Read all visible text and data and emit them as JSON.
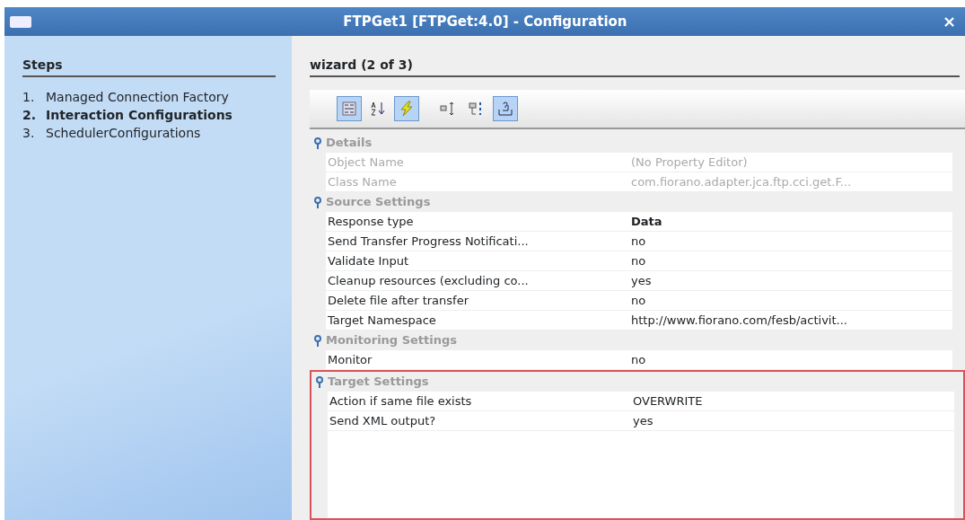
{
  "window": {
    "title": "FTPGet1 [FTPGet:4.0] - Configuration",
    "close": "×"
  },
  "steps": {
    "heading": "Steps",
    "items": [
      {
        "number": "1.",
        "label": "Managed Connection Factory",
        "selected": false
      },
      {
        "number": "2.",
        "label": "Interaction Configurations",
        "selected": true
      },
      {
        "number": "3.",
        "label": "SchedulerConfigurations",
        "selected": false
      }
    ]
  },
  "wizard": {
    "heading": "wizard (2 of 3)"
  },
  "toolbar": [
    {
      "kind": "categorized",
      "selected": true
    },
    {
      "kind": "sort",
      "selected": false
    },
    {
      "kind": "lightning",
      "selected": true
    },
    {
      "kind": "expand",
      "selected": false
    },
    {
      "kind": "collapse",
      "selected": false
    },
    {
      "kind": "help",
      "selected": true
    }
  ],
  "property_sheet": {
    "categories": [
      {
        "name": "Details",
        "highlighted": false,
        "properties": [
          {
            "name": "Object Name",
            "value": "(No Property Editor)",
            "disabled": true,
            "bold": false
          },
          {
            "name": "Class Name",
            "value": "com.fiorano.adapter.jca.ftp.cci.get.F...",
            "disabled": true,
            "bold": false
          }
        ]
      },
      {
        "name": "Source Settings",
        "highlighted": false,
        "properties": [
          {
            "name": "Response type",
            "value": "Data",
            "disabled": false,
            "bold": true
          },
          {
            "name": "Send Transfer Progress Notificati...",
            "value": "no",
            "disabled": false,
            "bold": false
          },
          {
            "name": "Validate Input",
            "value": "no",
            "disabled": false,
            "bold": false
          },
          {
            "name": "Cleanup resources (excluding co...",
            "value": "yes",
            "disabled": false,
            "bold": false
          },
          {
            "name": "Delete file after transfer",
            "value": "no",
            "disabled": false,
            "bold": false
          },
          {
            "name": "Target Namespace",
            "value": "http://www.fiorano.com/fesb/activit...",
            "disabled": false,
            "bold": false
          }
        ]
      },
      {
        "name": "Monitoring Settings",
        "highlighted": false,
        "properties": [
          {
            "name": "Monitor",
            "value": "no",
            "disabled": false,
            "bold": false
          }
        ]
      },
      {
        "name": "Target Settings",
        "highlighted": true,
        "properties": [
          {
            "name": "Action if same file exists",
            "value": "OVERWRITE",
            "disabled": false,
            "bold": false
          },
          {
            "name": "Send XML output?",
            "value": "yes",
            "disabled": false,
            "bold": false
          }
        ]
      }
    ]
  }
}
